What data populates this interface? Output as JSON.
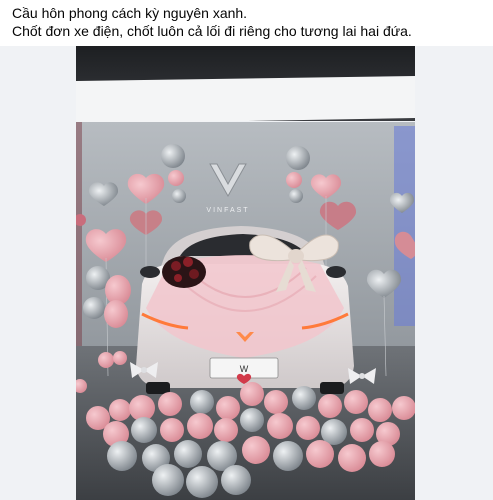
{
  "post": {
    "caption_line1": "Cầu hôn phong cách kỳ nguyên xanh.",
    "caption_line2": "Chốt đơn xe điện, chốt luôn cả lối đi riêng cho tương lai hai đứa."
  },
  "photo": {
    "brand_sign": "VINFAST",
    "plate_text": "W",
    "colors": {
      "pink_balloon": "#e8a6ae",
      "silver_balloon": "#a9afb6",
      "car_body": "#e9e4e4",
      "tulle": "#f2c6cc",
      "headlight": "#ff7a3a"
    }
  }
}
